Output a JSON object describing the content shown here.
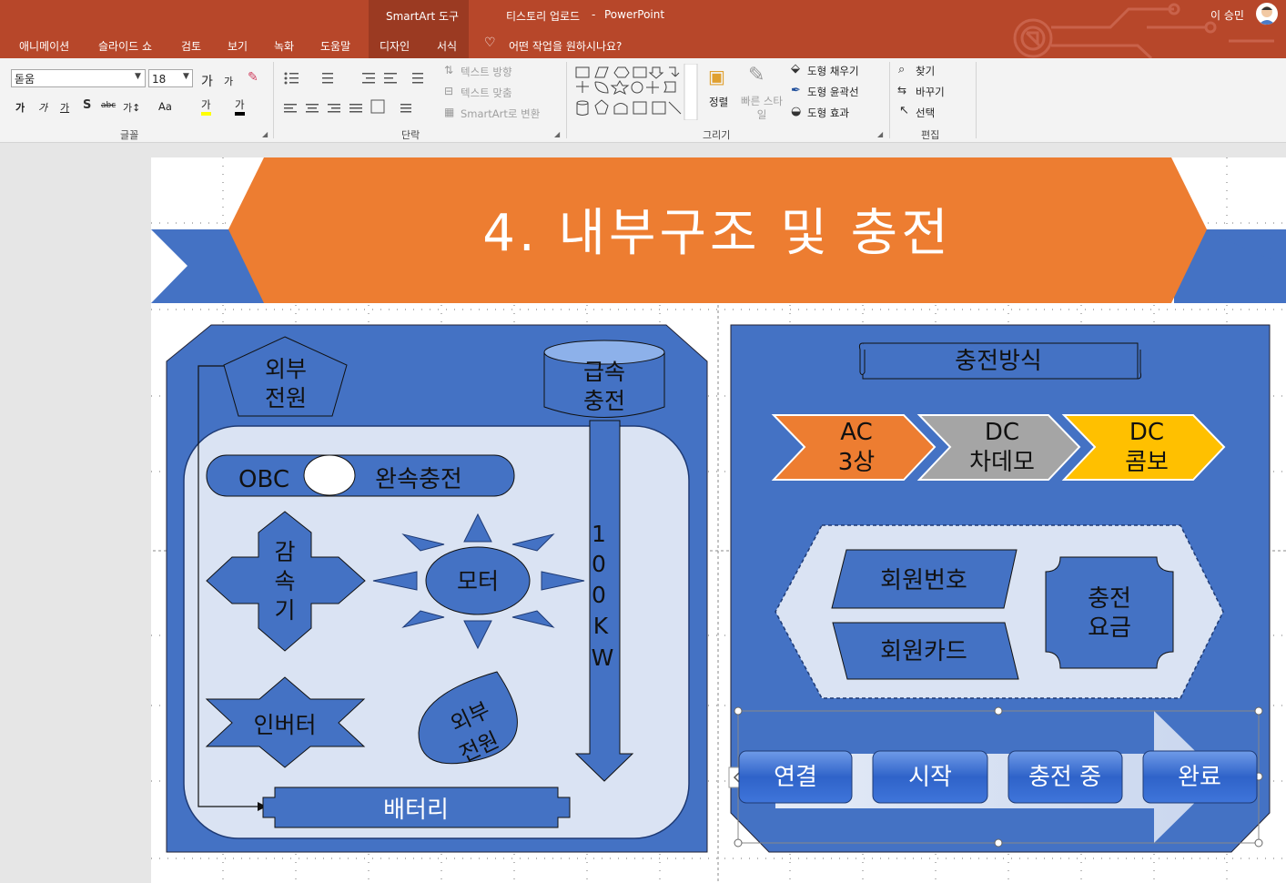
{
  "titlebar": {
    "context_group": "SmartArt 도구",
    "doc_title": "티스토리 업로드",
    "dash": "-",
    "app_name": "PowerPoint",
    "user_name": "이 승민"
  },
  "tabs": [
    "애니메이션",
    "슬라이드 쇼",
    "검토",
    "보기",
    "녹화",
    "도움말",
    "디자인",
    "서식"
  ],
  "tell_me": "어떤 작업을 원하시나요?",
  "ribbon": {
    "font": {
      "name": "돋움",
      "size": "18",
      "label": "글꼴",
      "grow": "가",
      "shrink": "가",
      "bold": "가",
      "italic": "가",
      "underline": "가",
      "strike": "abc",
      "spacing": "가↕",
      "case": "Aa",
      "highlight": "가",
      "color": "가"
    },
    "paragraph": {
      "label": "단락",
      "text_direction": "텍스트 방향",
      "align_text": "텍스트 맞춤",
      "convert_smartart": "SmartArt로 변환"
    },
    "drawing": {
      "label": "그리기",
      "arrange": "정렬",
      "quick_styles": "빠른 스타일",
      "shape_fill": "도형 채우기",
      "shape_outline": "도형 윤곽선",
      "shape_effects": "도형 효과"
    },
    "editing": {
      "label": "편집",
      "find": "찾기",
      "replace": "바꾸기",
      "select": "선택"
    }
  },
  "slide": {
    "title": "4. 내부구조 및 충전",
    "left_panel": {
      "external_power": [
        "외부",
        "전원"
      ],
      "fast_charge": [
        "급속",
        "충전"
      ],
      "obc": "OBC",
      "slow_charge": "완속충전",
      "reducer": [
        "감",
        "속",
        "기"
      ],
      "motor": "모터",
      "power_rating": "100KW",
      "inverter": "인버터",
      "external_power_2": [
        "외부",
        "전원"
      ],
      "battery": "배터리"
    },
    "right_panel": {
      "charging_method": "충전방식",
      "types": [
        {
          "line1": "AC",
          "line2": "3상",
          "color": "#ed7d31"
        },
        {
          "line1": "DC",
          "line2": "차데모",
          "color": "#a5a5a5"
        },
        {
          "line1": "DC",
          "line2": "콤보",
          "color": "#ffc000"
        }
      ],
      "member_number": "회원번호",
      "member_card": "회원카드",
      "charge_fee": [
        "충전",
        "요금"
      ],
      "process": [
        "연결",
        "시작",
        "충전 중",
        "완료"
      ]
    }
  },
  "colors": {
    "accent": "#b7472a",
    "slide_blue": "#4472c4",
    "slide_orange": "#ed7d31",
    "light_fill": "#dae3f3"
  }
}
